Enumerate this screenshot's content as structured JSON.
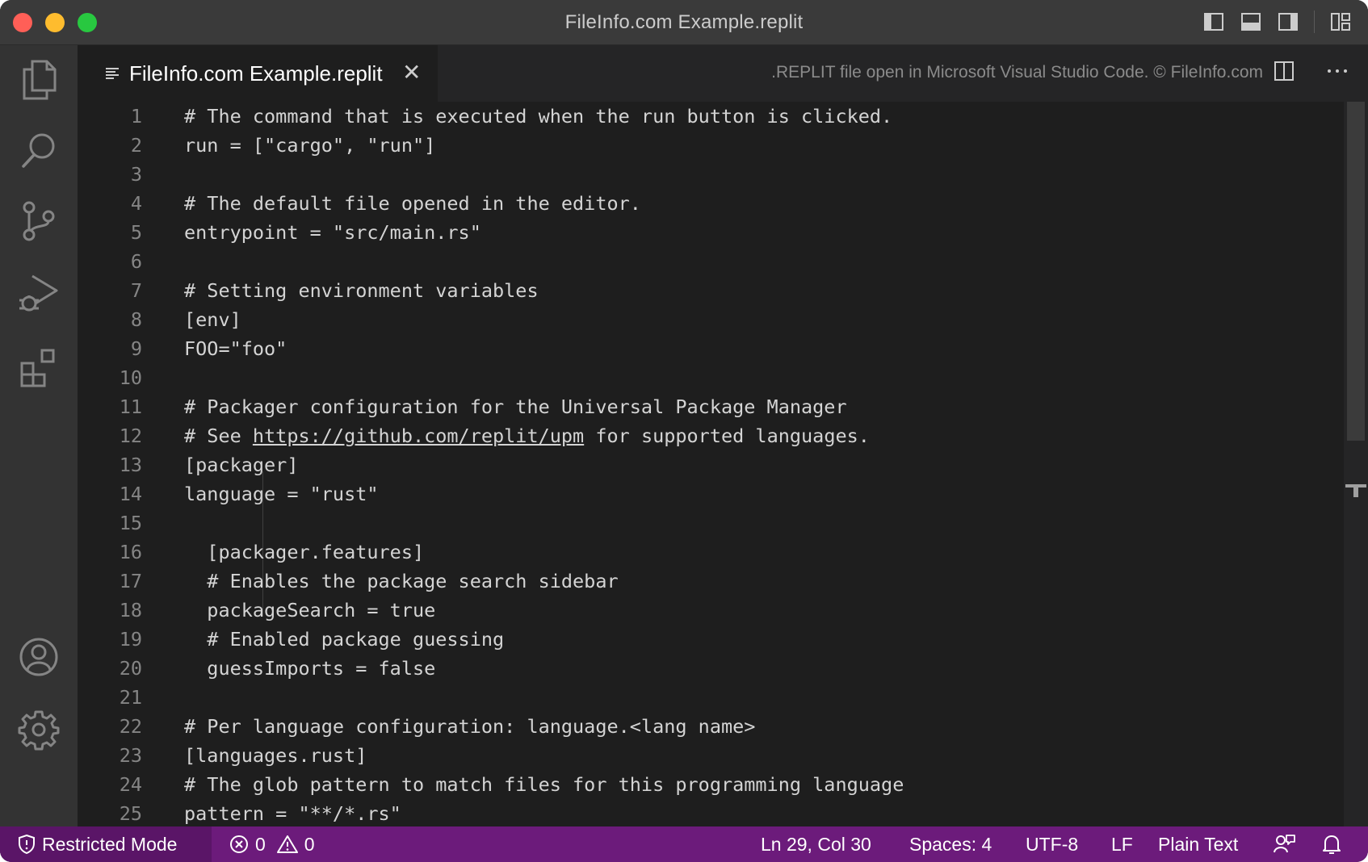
{
  "window": {
    "title": "FileInfo.com Example.replit"
  },
  "tab": {
    "label": "FileInfo.com Example.replit",
    "close_glyph": "✕",
    "note": ".REPLIT file open in Microsoft Visual Studio Code. © FileInfo.com"
  },
  "editor": {
    "lines": [
      {
        "n": "1",
        "code": "# The command that is executed when the run button is clicked."
      },
      {
        "n": "2",
        "code": "run = [\"cargo\", \"run\"]"
      },
      {
        "n": "3",
        "code": ""
      },
      {
        "n": "4",
        "code": "# The default file opened in the editor."
      },
      {
        "n": "5",
        "code": "entrypoint = \"src/main.rs\""
      },
      {
        "n": "6",
        "code": ""
      },
      {
        "n": "7",
        "code": "# Setting environment variables"
      },
      {
        "n": "8",
        "code": "[env]"
      },
      {
        "n": "9",
        "code": "FOO=\"foo\""
      },
      {
        "n": "10",
        "code": ""
      },
      {
        "n": "11",
        "code": "# Packager configuration for the Universal Package Manager"
      },
      {
        "n": "12",
        "code_prefix": "# See ",
        "link": "https://github.com/replit/upm",
        "code_suffix": " for supported languages."
      },
      {
        "n": "13",
        "code": "[packager]"
      },
      {
        "n": "14",
        "code": "language = \"rust\""
      },
      {
        "n": "15",
        "code": ""
      },
      {
        "n": "16",
        "code": "  [packager.features]"
      },
      {
        "n": "17",
        "code": "  # Enables the package search sidebar"
      },
      {
        "n": "18",
        "code": "  packageSearch = true"
      },
      {
        "n": "19",
        "code": "  # Enabled package guessing"
      },
      {
        "n": "20",
        "code": "  guessImports = false"
      },
      {
        "n": "21",
        "code": ""
      },
      {
        "n": "22",
        "code": "# Per language configuration: language.<lang name>"
      },
      {
        "n": "23",
        "code": "[languages.rust]"
      },
      {
        "n": "24",
        "code": "# The glob pattern to match files for this programming language"
      },
      {
        "n": "25",
        "code": "pattern = \"**/*.rs\""
      }
    ]
  },
  "statusbar": {
    "restricted_mode": "Restricted Mode",
    "errors": "0",
    "warnings": "0",
    "position": "Ln 29, Col 30",
    "spaces": "Spaces: 4",
    "encoding": "UTF-8",
    "eol": "LF",
    "language": "Plain Text"
  },
  "colors": {
    "statusbar_bg": "#6c1b7b",
    "restricted_bg": "#5a1567",
    "editor_bg": "#1e1e1e",
    "activity_bg": "#333333",
    "titlebar_bg": "#3a3a3a"
  },
  "icons": {
    "activity": [
      "files-icon",
      "search-icon",
      "source-control-icon",
      "run-debug-icon",
      "extensions-icon",
      "accounts-icon",
      "settings-gear-icon"
    ]
  }
}
